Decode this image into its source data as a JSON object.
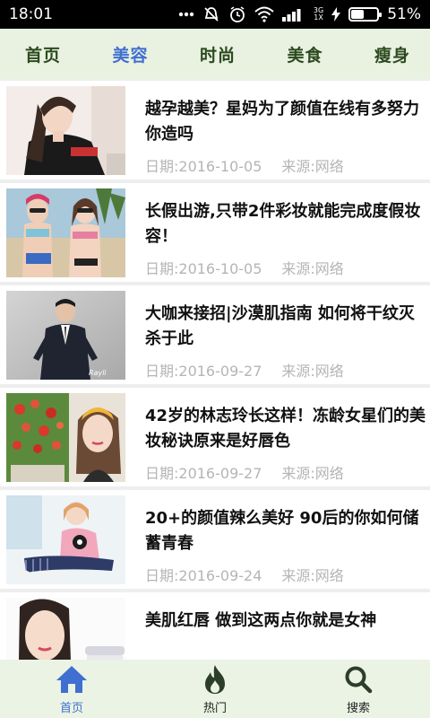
{
  "status_bar": {
    "time": "18:01",
    "network_badge_top": "3G",
    "network_badge_bottom": "1X",
    "battery_percent_label": "51%",
    "battery_level": 0.51
  },
  "tabs": [
    {
      "label": "首页",
      "active": false
    },
    {
      "label": "美容",
      "active": true
    },
    {
      "label": "时尚",
      "active": false
    },
    {
      "label": "美食",
      "active": false
    },
    {
      "label": "瘦身",
      "active": false
    }
  ],
  "articles": [
    {
      "title": "越孕越美？星妈为了颜值在线有多努力你造吗",
      "date": "日期:2016-10-05",
      "source": "来源:网络",
      "thumb": "woman-in-black-tshirt-photo"
    },
    {
      "title": "长假出游,只带2件彩妆就能完成度假妆容！",
      "date": "日期:2016-10-05",
      "source": "来源:网络",
      "thumb": "two-women-swimwear-photo"
    },
    {
      "title": "大咖来接招|沙漠肌指南 如何将干纹灭杀于此",
      "date": "日期:2016-09-27",
      "source": "来源:网络",
      "thumb": "man-in-suit-photo"
    },
    {
      "title": "42岁的林志玲长这样！冻龄女星们的美妆秘诀原来是好唇色",
      "date": "日期:2016-09-27",
      "source": "来源:网络",
      "thumb": "woman-with-flowers-photo"
    },
    {
      "title": "20+的颜值辣么美好 90后的你如何储蓄青春",
      "date": "日期:2016-09-24",
      "source": "来源:网络",
      "thumb": "girl-sitting-photo"
    },
    {
      "title": "美肌红唇 做到这两点你就是女神",
      "date": "",
      "source": "",
      "thumb": "woman-skincare-photo"
    }
  ],
  "bottom_nav": [
    {
      "label": "首页",
      "icon": "home-icon",
      "active": true
    },
    {
      "label": "热门",
      "icon": "flame-icon",
      "active": false
    },
    {
      "label": "搜索",
      "icon": "search-icon",
      "active": false
    }
  ],
  "colors": {
    "accent": "#3f6fd0",
    "tab_bar_bg": "#e9f1e1",
    "bottom_nav_bg": "#eaf3e4"
  }
}
